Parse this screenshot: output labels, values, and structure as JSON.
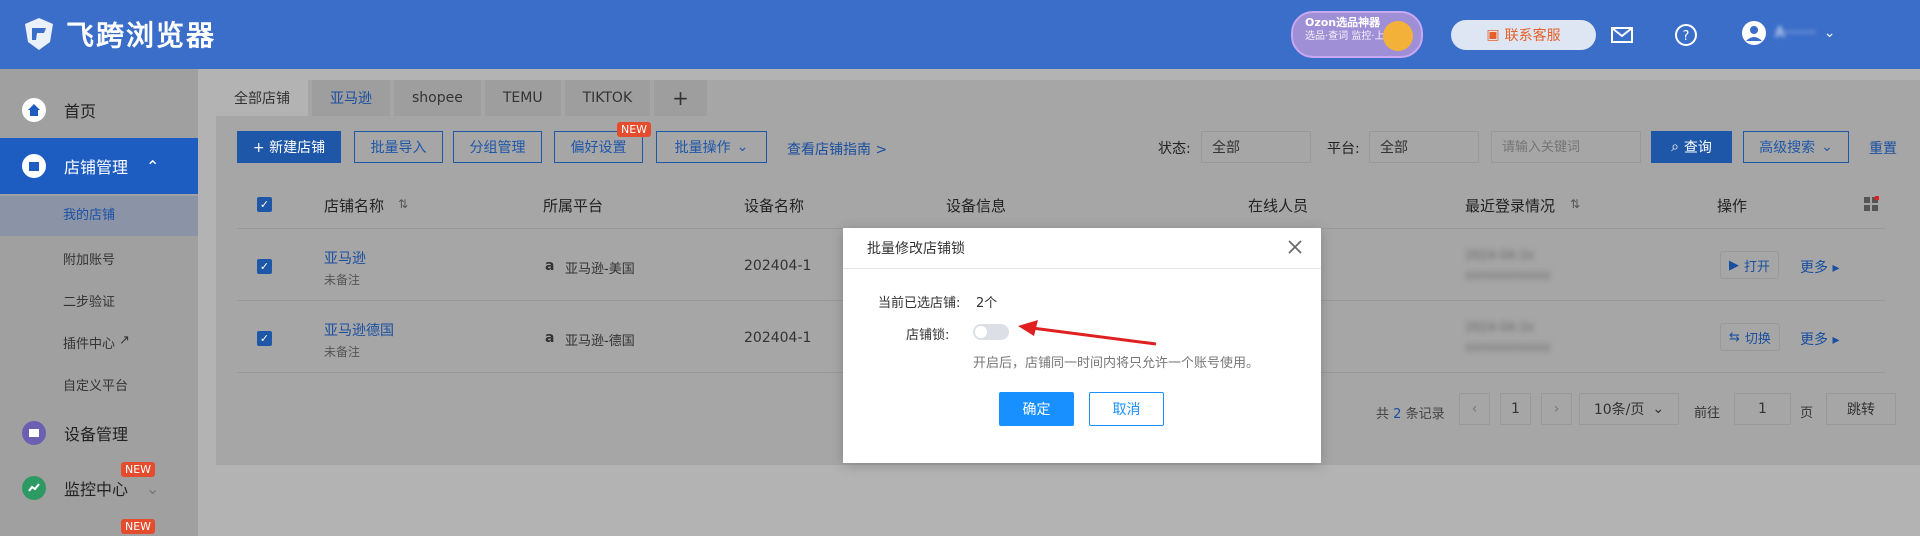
{
  "app": {
    "name": "飞跨浏览器"
  },
  "header": {
    "ozon_title": "Ozon选品神器",
    "ozon_sub": "选品·查词 监控·上货",
    "service_label": "联系客服",
    "user_name": "A·······"
  },
  "sidebar": {
    "home": "首页",
    "store_mgmt": "店铺管理",
    "subs": [
      "我的店铺",
      "附加账号",
      "二步验证",
      "插件中心",
      "自定义平台"
    ],
    "device_mgmt": "设备管理",
    "monitor": "监控中心",
    "new_tag": "NEW"
  },
  "tabs": [
    "全部店铺",
    "亚马逊",
    "shopee",
    "TEMU",
    "TIKTOK",
    "+"
  ],
  "toolbar": {
    "new_store": "+ 新建店铺",
    "batch_import": "批量导入",
    "group_mgmt": "分组管理",
    "pref_settings": "偏好设置",
    "new_tag": "NEW",
    "batch_ops": "批量操作",
    "guide_link": "查看店铺指南 >",
    "status_label": "状态:",
    "status_value": "全部",
    "platform_label": "平台:",
    "platform_value": "全部",
    "keyword_placeholder": "请输入关键词",
    "search": "查询",
    "advanced": "高级搜索",
    "reset": "重置"
  },
  "table": {
    "headers": [
      "店铺名称",
      "所属平台",
      "设备名称",
      "设备信息",
      "在线人员",
      "最近登录情况",
      "操作"
    ],
    "rows": [
      {
        "name": "亚马逊",
        "note": "未备注",
        "platform": "亚马逊-美国",
        "device": "202404-1",
        "login1": "2024-04-2x",
        "login2": "xxxxxxxxxxxx",
        "op": "打开",
        "more": "更多"
      },
      {
        "name": "亚马逊德国",
        "note": "未备注",
        "platform": "亚马逊-德国",
        "device": "202404-1",
        "login1": "2024-04-2x",
        "login2": "xxxxxxxxxxxx",
        "op": "切换",
        "more": "更多"
      }
    ]
  },
  "pagination": {
    "total_prefix": "共",
    "total": "2",
    "total_suffix": "条记录",
    "page": "1",
    "page_size": "10条/页",
    "goto_label": "前往",
    "goto_value": "1",
    "page_unit": "页",
    "jump": "跳转"
  },
  "modal": {
    "title": "批量修改店铺锁",
    "selected_label": "当前已选店铺:",
    "selected_value": "2个",
    "lock_label": "店铺锁:",
    "lock_on": false,
    "hint": "开启后，店铺同一时间内将只允许一个账号使用。",
    "ok": "确定",
    "cancel": "取消"
  },
  "colors": {
    "brand": "#3b6ec9",
    "primary": "#1890ff",
    "new_tag": "#e44c2d",
    "arrow": "#e02020"
  }
}
